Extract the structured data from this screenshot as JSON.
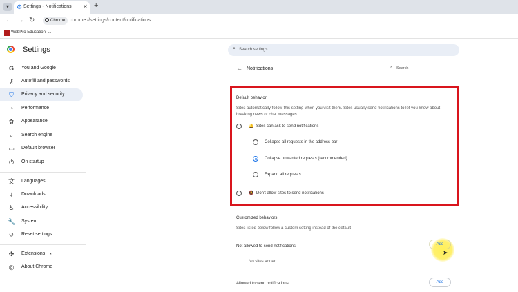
{
  "browser": {
    "tab_title": "Settings - Notifications",
    "tab_close": "✕",
    "new_tab": "+",
    "site_chip": "Chrome",
    "url": "chrome://settings/content/notifications",
    "bookmark": "WebPro Education -..."
  },
  "settings": {
    "title": "Settings",
    "search_placeholder": "Search settings"
  },
  "sidebar": {
    "items": [
      {
        "label": "You and Google",
        "icon": "google-g-icon"
      },
      {
        "label": "Autofill and passwords",
        "icon": "key-icon"
      },
      {
        "label": "Privacy and security",
        "icon": "shield-icon",
        "active": true
      },
      {
        "label": "Performance",
        "icon": "speedometer-icon"
      },
      {
        "label": "Appearance",
        "icon": "palette-icon"
      },
      {
        "label": "Search engine",
        "icon": "search-icon"
      },
      {
        "label": "Default browser",
        "icon": "browser-window-icon"
      },
      {
        "label": "On startup",
        "icon": "power-icon"
      },
      {
        "label": "Languages",
        "icon": "translate-icon"
      },
      {
        "label": "Downloads",
        "icon": "download-icon"
      },
      {
        "label": "Accessibility",
        "icon": "accessibility-icon"
      },
      {
        "label": "System",
        "icon": "wrench-icon"
      },
      {
        "label": "Reset settings",
        "icon": "reset-icon"
      },
      {
        "label": "Extensions",
        "icon": "puzzle-icon"
      },
      {
        "label": "About Chrome",
        "icon": "chrome-icon"
      }
    ]
  },
  "notifications": {
    "title": "Notifications",
    "search_placeholder": "Search",
    "default_behavior": {
      "heading": "Default behavior",
      "description": "Sites automatically follow this setting when you visit them. Sites usually send notifications to let you know about breaking news or chat messages.",
      "allow_label": "Sites can ask to send notifications",
      "sub_options": [
        {
          "label": "Collapse all requests in the address bar",
          "checked": false
        },
        {
          "label": "Collapse unwanted requests (recommended)",
          "checked": true
        },
        {
          "label": "Expand all requests",
          "checked": false
        }
      ],
      "block_label": "Don't allow sites to send notifications"
    },
    "customized": {
      "heading": "Customized behaviors",
      "description": "Sites listed below follow a custom setting instead of the default",
      "not_allowed_label": "Not allowed to send notifications",
      "no_sites": "No sites added",
      "allowed_label": "Allowed to send notifications",
      "add_label": "Add"
    }
  },
  "colors": {
    "accent": "#1a73e8",
    "highlight_border": "#d9151d",
    "active_nav_bg": "#e9eef6"
  }
}
